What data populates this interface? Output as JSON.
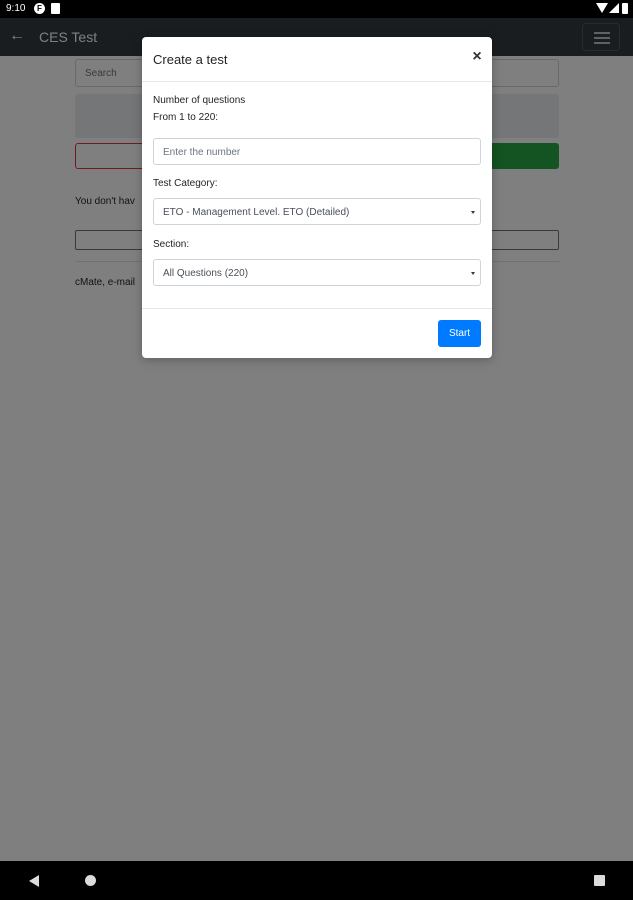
{
  "status_bar": {
    "time": "9:10",
    "icons": [
      "app-f-icon",
      "sd-card-icon",
      "wifi-icon",
      "signal-icon",
      "battery-icon"
    ]
  },
  "app_bar": {
    "title": "CES Test",
    "back_icon": "arrow-left-icon",
    "menu_icon": "hamburger-icon"
  },
  "page": {
    "search_placeholder": "Search",
    "notice_text": "You don't hav",
    "footer_text": "cMate, e-mail"
  },
  "modal": {
    "title": "Create a test",
    "close_label": "×",
    "num_label_line1": "Number of questions",
    "num_label_line2": "From 1 to 220:",
    "num_placeholder": "Enter the number",
    "category_label": "Test Category:",
    "category_value": "ETO - Management Level. ETO (Detailed)",
    "section_label": "Section:",
    "section_value": "All Questions (220)",
    "start_label": "Start"
  },
  "colors": {
    "primary": "#007bff",
    "success": "#28a745",
    "danger": "#dc3545",
    "appbar": "#343a40"
  },
  "nav_bar": {
    "icons": [
      "back-triangle-icon",
      "home-circle-icon",
      "recents-square-icon"
    ]
  }
}
